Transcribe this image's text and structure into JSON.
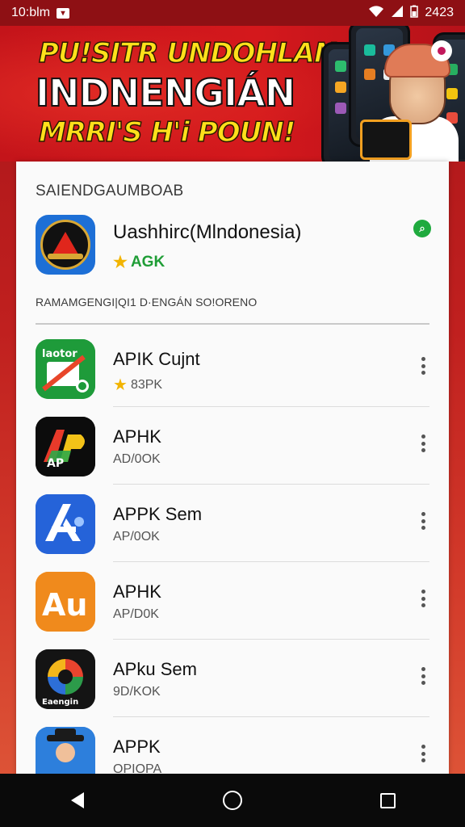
{
  "status_bar": {
    "left_text": "10:blm",
    "time": "2423"
  },
  "banner": {
    "line1": "PU!SITR UNDOHLAN",
    "line2": "INDNENGIÁN",
    "line3": "MRRI'S H'i POUN!"
  },
  "main": {
    "section_title": "SAIENDGAUMBOAB",
    "featured": {
      "name": "Uashhirc(Mlndonesia)",
      "rating_label": "AGK",
      "icon": "shield-emblem-icon"
    },
    "subsection_title": "RAMAMGENGI|QI1 D·ENGÁN SO!ORENO",
    "apps": [
      {
        "name": "APIK Cujnt",
        "meta": "83PK",
        "has_star": true,
        "icon": "whistle-app-icon",
        "icon_text": "laotor"
      },
      {
        "name": "APHK",
        "meta": "AD/0OK",
        "has_star": false,
        "icon": "ap-logo-icon",
        "icon_text": "AP"
      },
      {
        "name": "APPK Sem",
        "meta": "AP/0OK",
        "has_star": false,
        "icon": "blue-a-logo-icon",
        "icon_text": "A"
      },
      {
        "name": "APHK",
        "meta": "AP/D0K",
        "has_star": false,
        "icon": "orange-a-logo-icon",
        "icon_text": "Au"
      },
      {
        "name": "APku Sem",
        "meta": "9D/KOK",
        "has_star": false,
        "icon": "colorful-ring-icon",
        "icon_text": "Eaengin"
      },
      {
        "name": "APPK",
        "meta": "OPIOPA",
        "has_star": false,
        "icon": "cowboy-character-icon",
        "icon_text": ""
      }
    ]
  },
  "colors": {
    "brand_red": "#c4141a",
    "banner_yellow": "#ffe01b",
    "rating_green": "#1f9d36"
  }
}
